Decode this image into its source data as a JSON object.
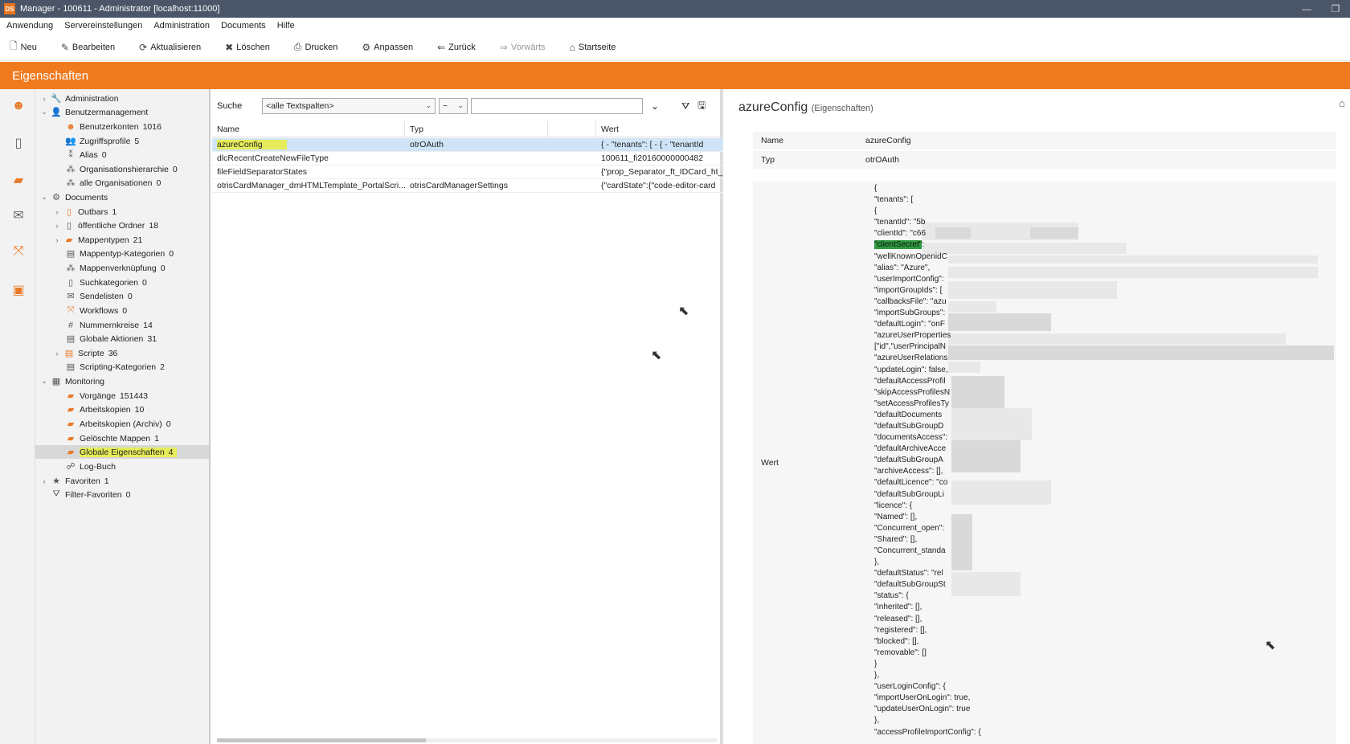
{
  "window": {
    "title": "Manager - 100611 - Administrator [localhost:11000]",
    "icon": "DS"
  },
  "menu": [
    "Anwendung",
    "Servereinstellungen",
    "Administration",
    "Documents",
    "Hilfe"
  ],
  "toolbar": [
    {
      "label": "Neu",
      "icon": "new-icon"
    },
    {
      "label": "Bearbeiten",
      "icon": "edit-icon"
    },
    {
      "label": "Aktualisieren",
      "icon": "refresh-icon"
    },
    {
      "label": "Löschen",
      "icon": "delete-icon"
    },
    {
      "label": "Drucken",
      "icon": "print-icon"
    },
    {
      "label": "Anpassen",
      "icon": "customize-icon"
    },
    {
      "label": "Zurück",
      "icon": "back-arrow-icon"
    },
    {
      "label": "Vorwärts",
      "icon": "forward-arrow-icon"
    },
    {
      "label": "Startseite",
      "icon": "home-icon"
    }
  ],
  "section_title": "Eigenschaften",
  "tree": [
    {
      "label": "Administration",
      "count": ""
    },
    {
      "label": "Benutzermanagement",
      "count": ""
    },
    {
      "label": "Benutzerkonten",
      "count": "1016"
    },
    {
      "label": "Zugriffsprofile",
      "count": "5"
    },
    {
      "label": "Alias",
      "count": "0"
    },
    {
      "label": "Organisationshierarchie",
      "count": "0"
    },
    {
      "label": "alle Organisationen",
      "count": "0"
    },
    {
      "label": "Documents",
      "count": ""
    },
    {
      "label": "Outbars",
      "count": "1"
    },
    {
      "label": "öffentliche Ordner",
      "count": "18"
    },
    {
      "label": "Mappentypen",
      "count": "21"
    },
    {
      "label": "Mappentyp-Kategorien",
      "count": "0"
    },
    {
      "label": "Mappenverknüpfung",
      "count": "0"
    },
    {
      "label": "Suchkategorien",
      "count": "0"
    },
    {
      "label": "Sendelisten",
      "count": "0"
    },
    {
      "label": "Workflows",
      "count": "0"
    },
    {
      "label": "Nummernkreise",
      "count": "14"
    },
    {
      "label": "Globale Aktionen",
      "count": "31"
    },
    {
      "label": "Scripte",
      "count": "36"
    },
    {
      "label": "Scripting-Kategorien",
      "count": "2"
    },
    {
      "label": "Monitoring",
      "count": ""
    },
    {
      "label": "Vorgänge",
      "count": "151443"
    },
    {
      "label": "Arbeitskopien",
      "count": "10"
    },
    {
      "label": "Arbeitskopien (Archiv)",
      "count": "0"
    },
    {
      "label": "Gelöschte Mappen",
      "count": "1"
    },
    {
      "label": "Globale Eigenschaften",
      "count": "4"
    },
    {
      "label": "Log-Buch",
      "count": ""
    },
    {
      "label": "Favoriten",
      "count": "1"
    },
    {
      "label": "Filter-Favoriten",
      "count": "0"
    }
  ],
  "search": {
    "label": "Suche",
    "column_select": "<alle Textspalten>",
    "operator": "~",
    "value": ""
  },
  "grid": {
    "columns": [
      "Name",
      "Typ",
      "Wert"
    ],
    "rows": [
      {
        "name": "azureConfig",
        "type": "otrOAuth",
        "value": "{ - \"tenants\": [ - { -  \"tenantId"
      },
      {
        "name": "dlcRecentCreateNewFileType",
        "type": "",
        "value": "100611_fi20160000000482"
      },
      {
        "name": "fileFieldSeparatorStates",
        "type": "",
        "value": "{\"prop_Separator_ft_IDCard_ht_["
      },
      {
        "name": "otrisCardManager_dmHTMLTemplate_PortalScri...",
        "type": "otrisCardManagerSettings",
        "value": "{\"cardState\":{\"code-editor-card"
      }
    ]
  },
  "detail": {
    "title": "azureConfig",
    "subtitle": "(Eigenschaften)",
    "name_label": "Name",
    "name_value": "azureConfig",
    "type_label": "Typ",
    "type_value": "otrOAuth",
    "value_label": "Wert",
    "json_lines": [
      "{",
      "\"tenants\": [",
      "{",
      "\"tenantId\": \"5b",
      "\"clientId\": \"c66",
      "\"clientSecret\":",
      "\"wellKnownOpenidC",
      "\"alias\": \"Azure\",",
      "\"userImportConfig\":",
      "\"importGroupIds\": [",
      "\"callbacksFile\": \"azu",
      "\"importSubGroups\":",
      "\"defaultLogin\": \"onF",
      "\"azureUserProperties",
      "[\"id\",\"userPrincipalN",
      "\"azureUserRelations",
      "\"updateLogin\": false,",
      "\"defaultAccessProfil",
      "\"skipAccessProfilesN",
      "\"setAccessProfilesTy",
      "\"defaultDocuments",
      "\"defaultSubGroupD",
      "\"documentsAccess\":",
      "\"defaultArchiveAcce",
      "\"defaultSubGroupA",
      "\"archiveAccess\": [],",
      "\"defaultLicence\": \"co",
      "\"defaultSubGroupLi",
      "\"licence\": {",
      "\"Named\": [],",
      "\"Concurrent_open\":",
      "\"Shared\": [],",
      "\"Concurrent_standa",
      "},",
      "\"defaultStatus\": \"rel",
      "\"defaultSubGroupSt",
      "\"status\": {",
      "\"inherited\": [],",
      "\"released\": [],",
      "\"registered\": [],",
      "\"blocked\": [],",
      "\"removable\": []",
      "}",
      "},",
      "\"userLoginConfig\": {",
      "\"importUserOnLogin\": true,",
      "\"updateUserOnLogin\": true",
      "},",
      "\"accessProfileImportConfig\": {"
    ]
  }
}
